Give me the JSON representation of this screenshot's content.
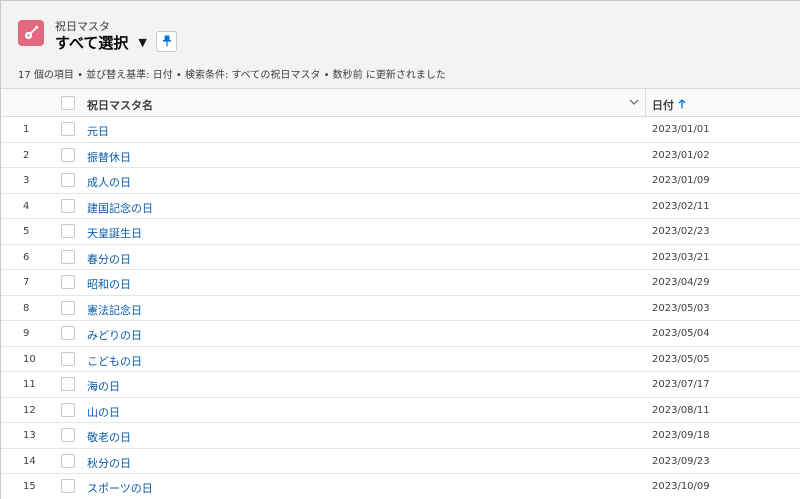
{
  "header": {
    "object_label": "祝日マスタ",
    "list_view_name": "すべて選択",
    "info_line": "17 個の項目 • 並び替え基準: 日付 • 検索条件: すべての祝日マスタ • 数秒前 に更新されました",
    "app_icon_color": "#e3687f",
    "app_icon": "guitar-icon",
    "pin_icon": "pin-icon"
  },
  "table": {
    "columns": {
      "name": "祝日マスタ名",
      "date": "日付"
    },
    "sort": {
      "column": "date",
      "direction": "ascending"
    },
    "rows": [
      {
        "num": "1",
        "name": "元日",
        "date": "2023/01/01"
      },
      {
        "num": "2",
        "name": "振替休日",
        "date": "2023/01/02"
      },
      {
        "num": "3",
        "name": "成人の日",
        "date": "2023/01/09"
      },
      {
        "num": "4",
        "name": "建国記念の日",
        "date": "2023/02/11"
      },
      {
        "num": "5",
        "name": "天皇誕生日",
        "date": "2023/02/23"
      },
      {
        "num": "6",
        "name": "春分の日",
        "date": "2023/03/21"
      },
      {
        "num": "7",
        "name": "昭和の日",
        "date": "2023/04/29"
      },
      {
        "num": "8",
        "name": "憲法記念日",
        "date": "2023/05/03"
      },
      {
        "num": "9",
        "name": "みどりの日",
        "date": "2023/05/04"
      },
      {
        "num": "10",
        "name": "こどもの日",
        "date": "2023/05/05"
      },
      {
        "num": "11",
        "name": "海の日",
        "date": "2023/07/17"
      },
      {
        "num": "12",
        "name": "山の日",
        "date": "2023/08/11"
      },
      {
        "num": "13",
        "name": "敬老の日",
        "date": "2023/09/18"
      },
      {
        "num": "14",
        "name": "秋分の日",
        "date": "2023/09/23"
      },
      {
        "num": "15",
        "name": "スポーツの日",
        "date": "2023/10/09"
      }
    ]
  },
  "colors": {
    "link": "#0b5cab",
    "accent": "#0176d3"
  }
}
